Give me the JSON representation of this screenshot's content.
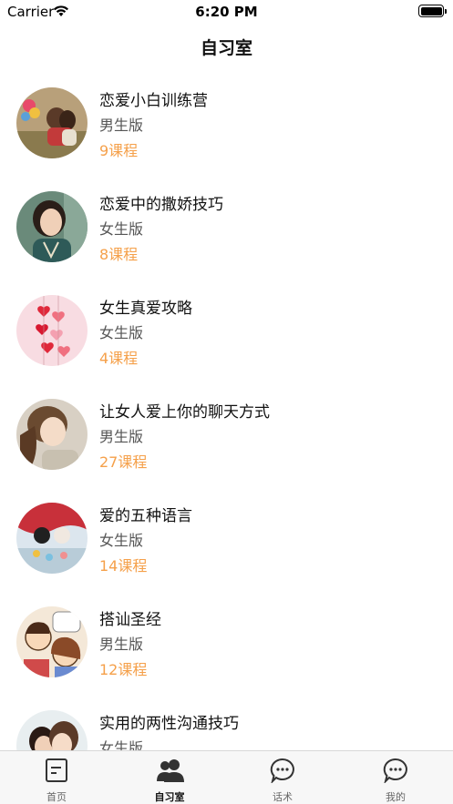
{
  "status_bar": {
    "carrier": "Carrier",
    "time": "6:20 PM"
  },
  "header": {
    "title": "自习室"
  },
  "courses": [
    {
      "title": "恋爱小白训练营",
      "edition": "男生版",
      "count": "9课程",
      "avatar": "couple-balloons-photo"
    },
    {
      "title": "恋爱中的撒娇技巧",
      "edition": "女生版",
      "count": "8课程",
      "avatar": "smiling-woman-photo"
    },
    {
      "title": "女生真爱攻略",
      "edition": "女生版",
      "count": "4课程",
      "avatar": "red-hearts-photo"
    },
    {
      "title": "让女人爱上你的聊天方式",
      "edition": "男生版",
      "count": "27课程",
      "avatar": "woman-portrait-photo"
    },
    {
      "title": "爱的五种语言",
      "edition": "女生版",
      "count": "14课程",
      "avatar": "couple-figurines-photo"
    },
    {
      "title": "搭讪圣经",
      "edition": "男生版",
      "count": "12课程",
      "avatar": "cartoon-couple-illustration"
    },
    {
      "title": "实用的两性沟通技巧",
      "edition": "女生版",
      "count": "",
      "avatar": "couple-closeup-photo"
    }
  ],
  "tabbar": {
    "tabs": [
      {
        "label": "首页",
        "icon": "home-note-icon",
        "active": false
      },
      {
        "label": "自习室",
        "icon": "people-icon",
        "active": true
      },
      {
        "label": "话术",
        "icon": "chat-bubble-icon",
        "active": false
      },
      {
        "label": "我的",
        "icon": "chat-bubble-icon",
        "active": false
      }
    ]
  },
  "colors": {
    "accent": "#f5a04a",
    "text": "#111111",
    "subtext": "#555555",
    "tabbar_bg": "#f7f7f7"
  }
}
